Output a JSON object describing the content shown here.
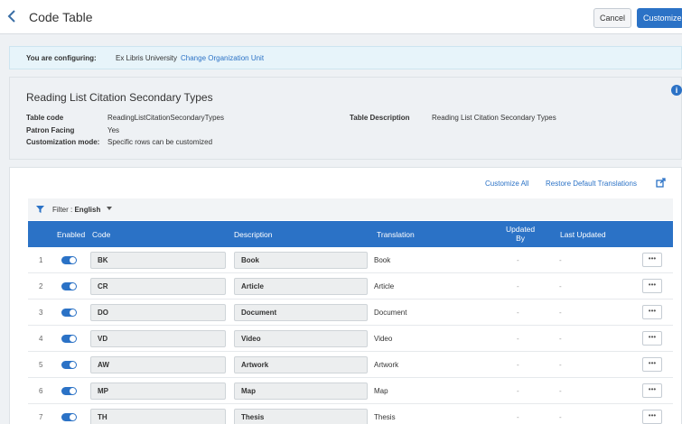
{
  "header": {
    "title": "Code Table",
    "cancel_label": "Cancel",
    "customize_label": "Customize"
  },
  "config": {
    "label": "You are configuring:",
    "org": "Ex Libris University",
    "change_link": "Change Organization Unit"
  },
  "info": {
    "title": "Reading List Citation Secondary Types",
    "table_code_key": "Table code",
    "table_code_val": "ReadingListCitationSecondaryTypes",
    "patron_facing_key": "Patron Facing",
    "patron_facing_val": "Yes",
    "customization_mode_key": "Customization mode:",
    "customization_mode_val": "Specific rows can be customized",
    "table_desc_key": "Table Description",
    "table_desc_val": "Reading List Citation Secondary Types"
  },
  "actions": {
    "customize_all": "Customize All",
    "restore_translations": "Restore Default Translations"
  },
  "filter": {
    "label": "Filter :",
    "value": "English"
  },
  "table": {
    "columns": {
      "enabled": "Enabled",
      "code": "Code",
      "description": "Description",
      "translation": "Translation",
      "updated_by_1": "Updated",
      "updated_by_2": "By",
      "last_updated": "Last Updated"
    },
    "rows": [
      {
        "idx": "1",
        "code": "BK",
        "description": "Book",
        "translation": "Book",
        "updated_by": "-",
        "last_updated": "-"
      },
      {
        "idx": "2",
        "code": "CR",
        "description": "Article",
        "translation": "Article",
        "updated_by": "-",
        "last_updated": "-"
      },
      {
        "idx": "3",
        "code": "DO",
        "description": "Document",
        "translation": "Document",
        "updated_by": "-",
        "last_updated": "-"
      },
      {
        "idx": "4",
        "code": "VD",
        "description": "Video",
        "translation": "Video",
        "updated_by": "-",
        "last_updated": "-"
      },
      {
        "idx": "5",
        "code": "AW",
        "description": "Artwork",
        "translation": "Artwork",
        "updated_by": "-",
        "last_updated": "-"
      },
      {
        "idx": "6",
        "code": "MP",
        "description": "Map",
        "translation": "Map",
        "updated_by": "-",
        "last_updated": "-"
      },
      {
        "idx": "7",
        "code": "TH",
        "description": "Thesis",
        "translation": "Thesis",
        "updated_by": "-",
        "last_updated": "-"
      }
    ],
    "more_label": "•••"
  },
  "colors": {
    "accent": "#2b72c6",
    "header_bg": "#2b72c6",
    "config_bg": "#e7f4fa"
  },
  "icons": {
    "back": "chevron-left-icon",
    "info": "info-icon",
    "external": "external-link-icon",
    "filter": "filter-icon"
  }
}
